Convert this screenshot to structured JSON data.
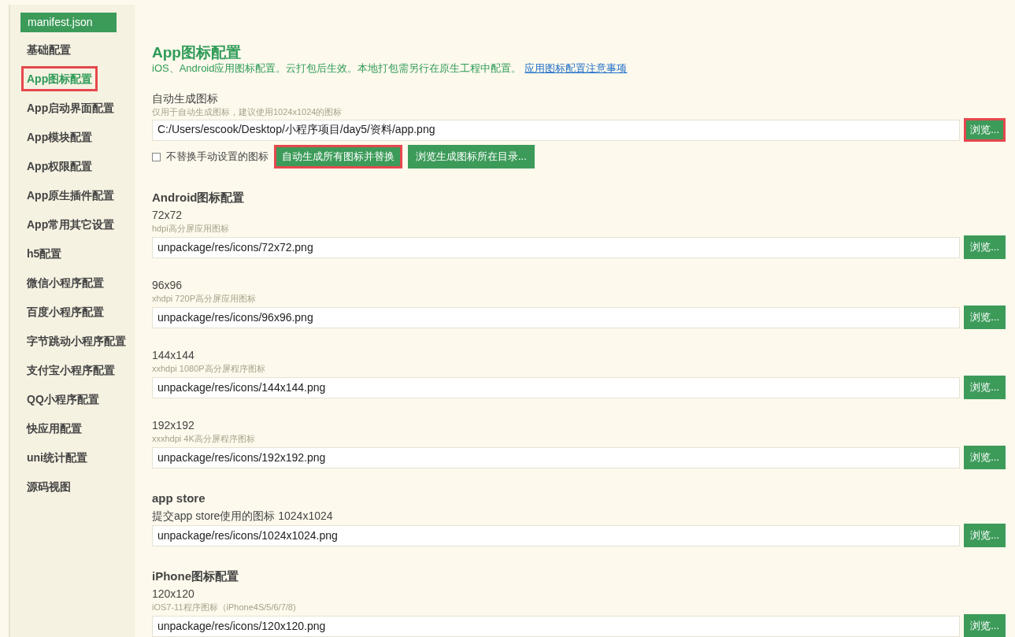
{
  "editor_tab": {
    "label": "manifest.json"
  },
  "sidebar": {
    "items": [
      {
        "label": "基础配置",
        "selected": false,
        "highlighted": false
      },
      {
        "label": "App图标配置",
        "selected": true,
        "highlighted": true
      },
      {
        "label": "App启动界面配置",
        "selected": false,
        "highlighted": false
      },
      {
        "label": "App模块配置",
        "selected": false,
        "highlighted": false
      },
      {
        "label": "App权限配置",
        "selected": false,
        "highlighted": false
      },
      {
        "label": "App原生插件配置",
        "selected": false,
        "highlighted": false
      },
      {
        "label": "App常用其它设置",
        "selected": false,
        "highlighted": false
      },
      {
        "label": "h5配置",
        "selected": false,
        "highlighted": false
      },
      {
        "label": "微信小程序配置",
        "selected": false,
        "highlighted": false
      },
      {
        "label": "百度小程序配置",
        "selected": false,
        "highlighted": false
      },
      {
        "label": "字节跳动小程序配置",
        "selected": false,
        "highlighted": false
      },
      {
        "label": "支付宝小程序配置",
        "selected": false,
        "highlighted": false
      },
      {
        "label": "QQ小程序配置",
        "selected": false,
        "highlighted": false
      },
      {
        "label": "快应用配置",
        "selected": false,
        "highlighted": false
      },
      {
        "label": "uni统计配置",
        "selected": false,
        "highlighted": false
      },
      {
        "label": "源码视图",
        "selected": false,
        "highlighted": false
      }
    ]
  },
  "page": {
    "title": "App图标配置",
    "description": "iOS、Android应用图标配置。云打包后生效。本地打包需另行在原生工程中配置。",
    "link": "应用图标配置注意事项"
  },
  "auto_generate": {
    "label": "自动生成图标",
    "hint": "仅用于自动生成图标，建议使用1024x1024的图标",
    "value": "C:/Users/escook/Desktop/小程序项目/day5/资料/app.png",
    "browse": {
      "label": "浏览...",
      "highlighted": true
    },
    "checkbox": {
      "label": "不替换手动设置的图标",
      "checked": false
    },
    "buttons": [
      {
        "label": "自动生成所有图标并替换",
        "highlighted": true
      },
      {
        "label": "浏览生成图标所在目录...",
        "highlighted": false
      }
    ]
  },
  "sections": [
    {
      "title": "Android图标配置",
      "fields": [
        {
          "label": "72x72",
          "hint": "hdpi高分屏应用图标",
          "value": "unpackage/res/icons/72x72.png",
          "browse": "浏览..."
        },
        {
          "label": "96x96",
          "hint": "xhdpi 720P高分屏应用图标",
          "value": "unpackage/res/icons/96x96.png",
          "browse": "浏览..."
        },
        {
          "label": "144x144",
          "hint": "xxhdpi 1080P高分屏程序图标",
          "value": "unpackage/res/icons/144x144.png",
          "browse": "浏览..."
        },
        {
          "label": "192x192",
          "hint": "xxxhdpi 4K高分屏程序图标",
          "value": "unpackage/res/icons/192x192.png",
          "browse": "浏览..."
        }
      ]
    },
    {
      "title": "app store",
      "fields": [
        {
          "label": "提交app store使用的图标 1024x1024",
          "value": "unpackage/res/icons/1024x1024.png",
          "browse": "浏览..."
        }
      ]
    },
    {
      "title": "iPhone图标配置",
      "fields": [
        {
          "label": "120x120",
          "hint": "iOS7-11程序图标（iPhone4S/5/6/7/8)",
          "value": "unpackage/res/icons/120x120.png",
          "browse": "浏览..."
        }
      ]
    }
  ]
}
